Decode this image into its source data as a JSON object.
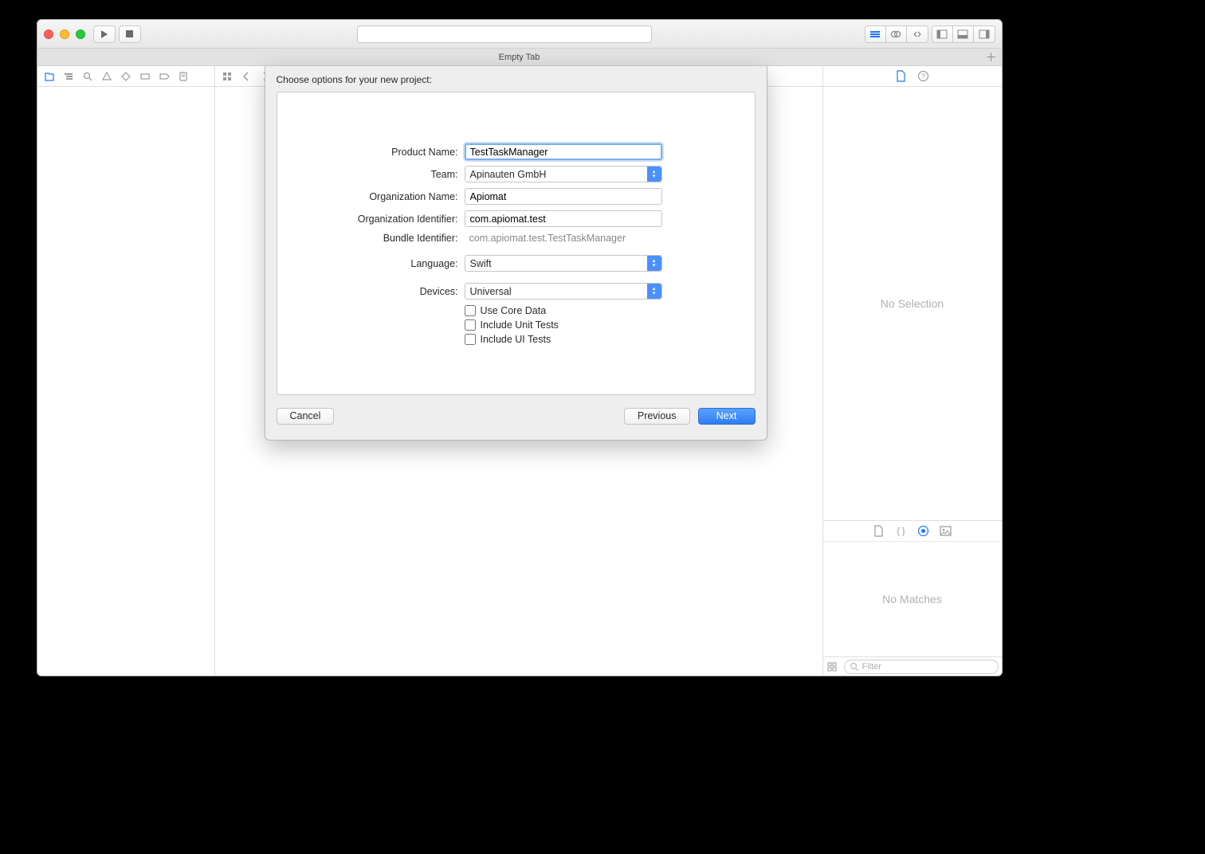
{
  "tabbar": {
    "title": "Empty Tab"
  },
  "inspector": {
    "empty_text": "No Selection"
  },
  "library": {
    "empty_text": "No Matches",
    "filter_placeholder": "Filter"
  },
  "sheet": {
    "heading": "Choose options for your new project:",
    "labels": {
      "product_name": "Product Name:",
      "team": "Team:",
      "org_name": "Organization Name:",
      "org_id": "Organization Identifier:",
      "bundle_id": "Bundle Identifier:",
      "language": "Language:",
      "devices": "Devices:"
    },
    "values": {
      "product_name": "TestTaskManager",
      "team": "Apinauten GmbH",
      "org_name": "Apiomat",
      "org_id": "com.apiomat.test",
      "bundle_id": "com.apiomat.test.TestTaskManager",
      "language": "Swift",
      "devices": "Universal"
    },
    "checkboxes": {
      "core_data": "Use Core Data",
      "unit_tests": "Include Unit Tests",
      "ui_tests": "Include UI Tests"
    },
    "buttons": {
      "cancel": "Cancel",
      "previous": "Previous",
      "next": "Next"
    }
  }
}
